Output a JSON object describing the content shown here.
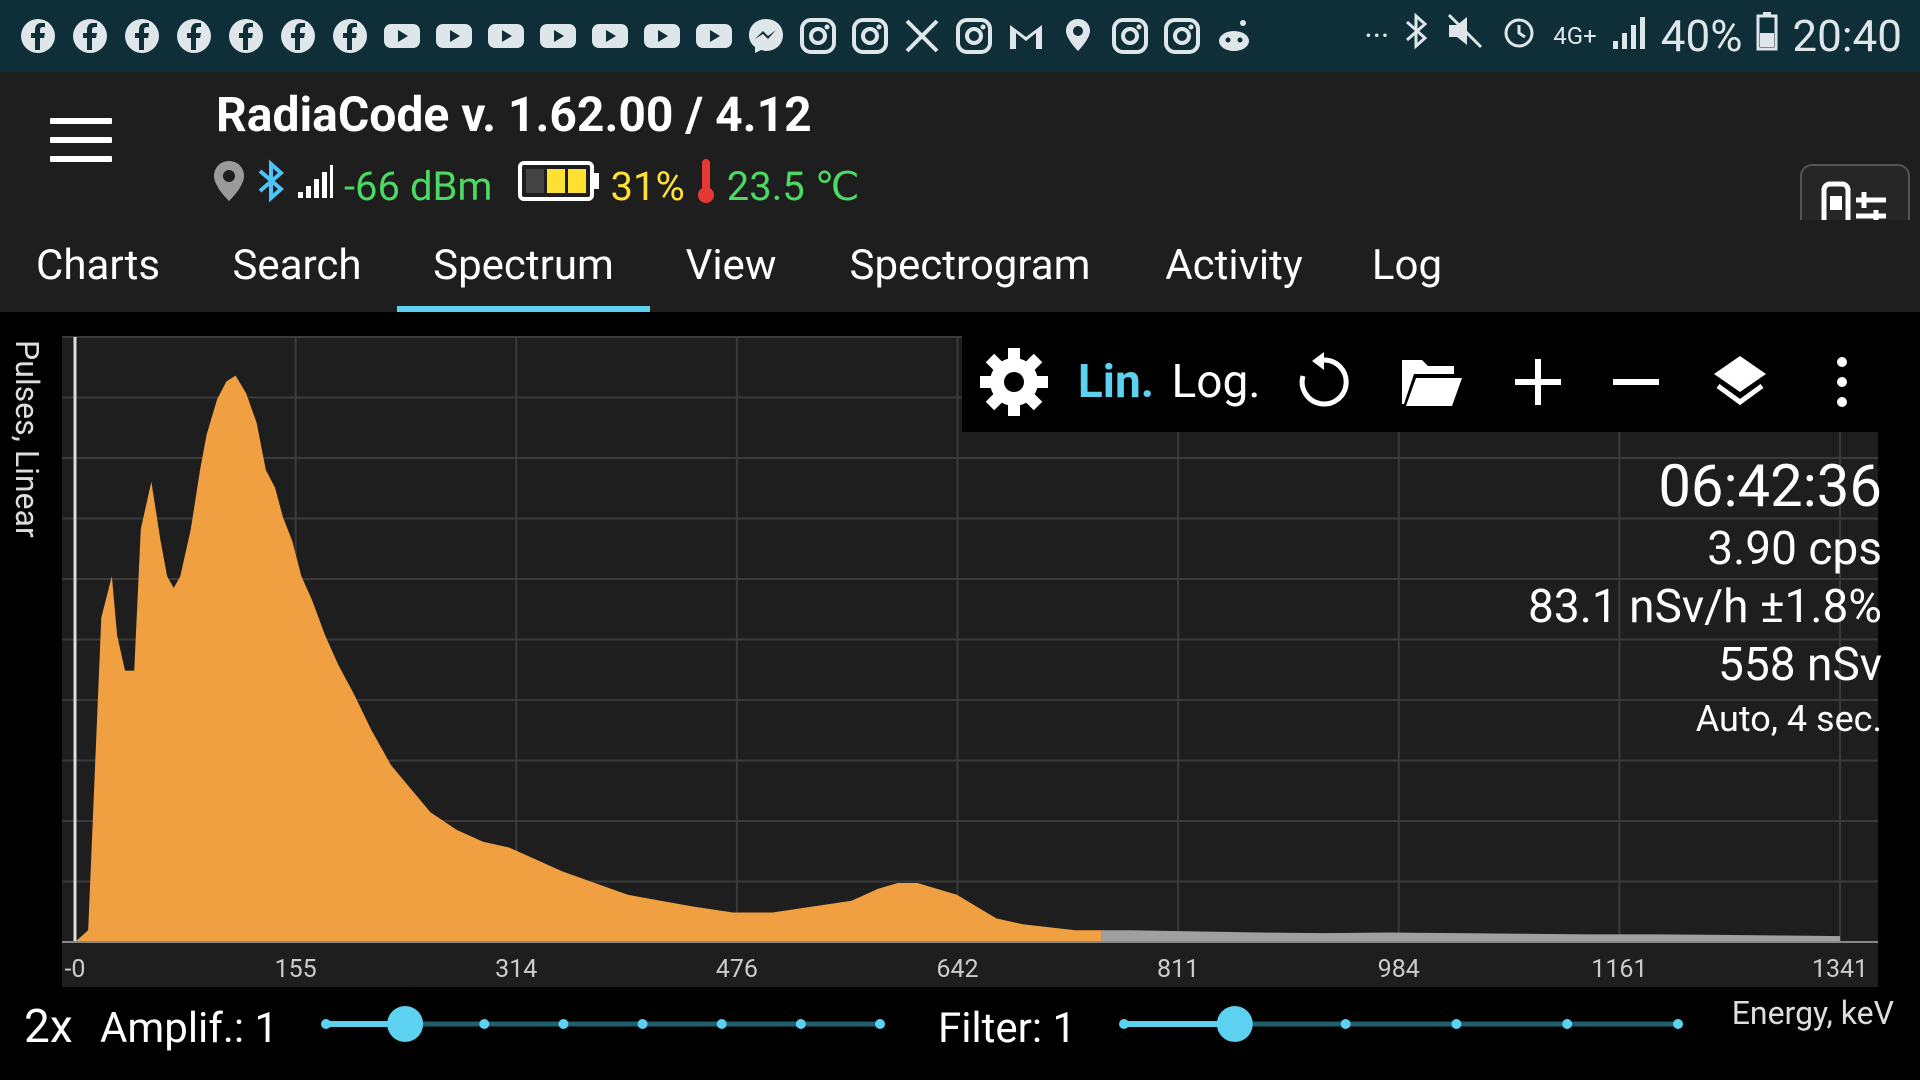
{
  "status_bar": {
    "notification_icons": [
      "facebook-icon",
      "facebook-icon",
      "facebook-icon",
      "facebook-icon",
      "facebook-icon",
      "facebook-icon",
      "facebook-icon",
      "youtube-icon",
      "youtube-icon",
      "youtube-icon",
      "youtube-icon",
      "youtube-icon",
      "youtube-icon",
      "youtube-icon",
      "messenger-icon",
      "instagram-icon",
      "instagram-icon",
      "x-icon",
      "instagram-icon",
      "gmail-icon",
      "maps-icon",
      "instagram-icon",
      "instagram-icon",
      "reddit-icon"
    ],
    "more": "···",
    "network": "4G+",
    "battery": "40%",
    "time": "20:40"
  },
  "app": {
    "title": "RadiaCode v. 1.62.00 / 4.12",
    "signal": "-66 dBm",
    "battery": "31%",
    "temperature": "23.5 ℃"
  },
  "tabs": [
    {
      "label": "Charts"
    },
    {
      "label": "Search"
    },
    {
      "label": "Spectrum",
      "active": true
    },
    {
      "label": "View"
    },
    {
      "label": "Spectrogram"
    },
    {
      "label": "Activity"
    },
    {
      "label": "Log"
    }
  ],
  "toolbar": {
    "lin_label": "Lin.",
    "log_label": "Log.",
    "icons": [
      "gear-icon",
      "refresh-icon",
      "folder-open-icon",
      "plus-icon",
      "minus-icon",
      "layers-icon",
      "more-vert-icon"
    ]
  },
  "readout": {
    "time": "06:42:36",
    "cps": "3.90 cps",
    "dose_rate": "83.1 nSv/h ±1.8%",
    "dose": "558 nSv",
    "mode": "Auto, 4 sec."
  },
  "axes": {
    "ylabel": "Pulses, Linear",
    "xlabel": "Energy, keV",
    "xticks": [
      "-0",
      "155",
      "314",
      "476",
      "642",
      "811",
      "984",
      "1161",
      "1341"
    ]
  },
  "controls": {
    "zoom": "2x",
    "amplif": "Amplif.: 1",
    "amplif_value": 1,
    "amplif_steps": 7,
    "filter": "Filter: 1",
    "filter_value": 1,
    "filter_steps": 5
  },
  "colors": {
    "spectrum": "#f0a040",
    "spectrum_tail": "#a0a0a0",
    "accent": "#5cd2f0",
    "status_bg": "#0e2e38"
  },
  "chart_data": {
    "type": "area",
    "xlabel": "Energy, keV",
    "ylabel": "Pulses, Linear",
    "xlim": [
      0,
      1341
    ],
    "ylim": [
      0,
      100
    ],
    "highlight_until_kev": 785,
    "x": [
      0,
      10,
      20,
      28,
      32,
      38,
      45,
      50,
      58,
      65,
      70,
      75,
      80,
      88,
      95,
      100,
      108,
      115,
      122,
      130,
      138,
      145,
      152,
      158,
      165,
      172,
      180,
      190,
      200,
      212,
      225,
      240,
      255,
      270,
      290,
      310,
      330,
      350,
      370,
      395,
      420,
      445,
      470,
      500,
      530,
      560,
      590,
      610,
      625,
      640,
      655,
      670,
      685,
      700,
      720,
      740,
      760,
      780,
      800,
      850,
      900,
      950,
      1000,
      1050,
      1100,
      1150,
      1200,
      1250,
      1300,
      1341
    ],
    "y": [
      0,
      2,
      55,
      62,
      52,
      46,
      46,
      70,
      78,
      68,
      62,
      60,
      62,
      70,
      80,
      86,
      92,
      95,
      96,
      93,
      88,
      80,
      77,
      72,
      68,
      62,
      58,
      52,
      47,
      42,
      36,
      30,
      26,
      22,
      19,
      17,
      16,
      14,
      12,
      10,
      8,
      7,
      6,
      5,
      5,
      6,
      7,
      9,
      10,
      10,
      9,
      8,
      6,
      4,
      3,
      2.5,
      2,
      2,
      2,
      1.8,
      1.6,
      1.5,
      1.6,
      1.5,
      1.4,
      1.3,
      1.3,
      1.2,
      1.1,
      1.0
    ]
  }
}
